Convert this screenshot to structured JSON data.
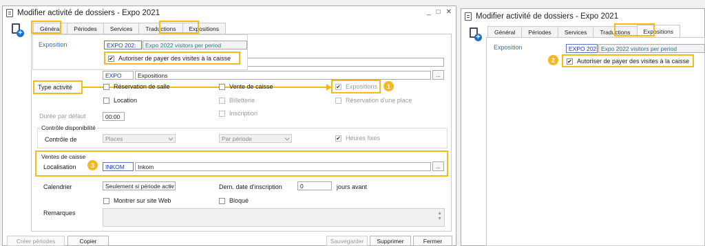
{
  "window": {
    "title": "Modifier activité de dossiers - Expo 2021",
    "controls": [
      "_",
      "□",
      "✕"
    ]
  },
  "tabs": [
    "Général",
    "Périodes",
    "Services",
    "Traductions",
    "Expositions"
  ],
  "expositions_panel": {
    "label": "Exposition",
    "code": "EXPO 202:",
    "description": "Expo 2022 visitors per period",
    "allow_pay_label": "Autoriser de payer des visites à la caisse"
  },
  "general": {
    "code_value": "EXPO",
    "code_desc": "Expositions",
    "type_activite_label": "Type activité",
    "type_options": {
      "reservation_salle": "Réservation de salle",
      "vente_caisse": "Vente de caisse",
      "expositions": "Expositions",
      "location": "Location",
      "billetterie": "Billetterie",
      "reservation_place": "Réservation d'une place",
      "inscription": "Inscription"
    },
    "duree_label": "Durée par défaut",
    "duree_value": "00:00",
    "controle_group": "Contrôle disponibilité",
    "controle_label": "Contrôle de",
    "controle_value": "Places",
    "periode_value": "Par période",
    "heures_fixes": "Heures fixes",
    "ventes_group": "Ventes de caisse",
    "localisation_label": "Localisation",
    "localisation_code": "INKOM",
    "localisation_desc": "Inkom",
    "calendrier_label": "Calendrier",
    "calendrier_value": "Seulement si période activ",
    "dern_label": "Dern. date d'inscription",
    "dern_value": "0",
    "jours_label": "jours avant",
    "montrer_web": "Montrer sur site Web",
    "bloque": "Bloqué",
    "remarques_label": "Remarques",
    "dots": "..."
  },
  "buttons": {
    "creer_periodes": "Créer périodes",
    "copier": "Copier",
    "sauvegarder": "Sauvegarder",
    "supprimer": "Supprimer",
    "fermer": "Fermer"
  },
  "badges": [
    "1",
    "2",
    "3"
  ],
  "check_mark": "✔"
}
